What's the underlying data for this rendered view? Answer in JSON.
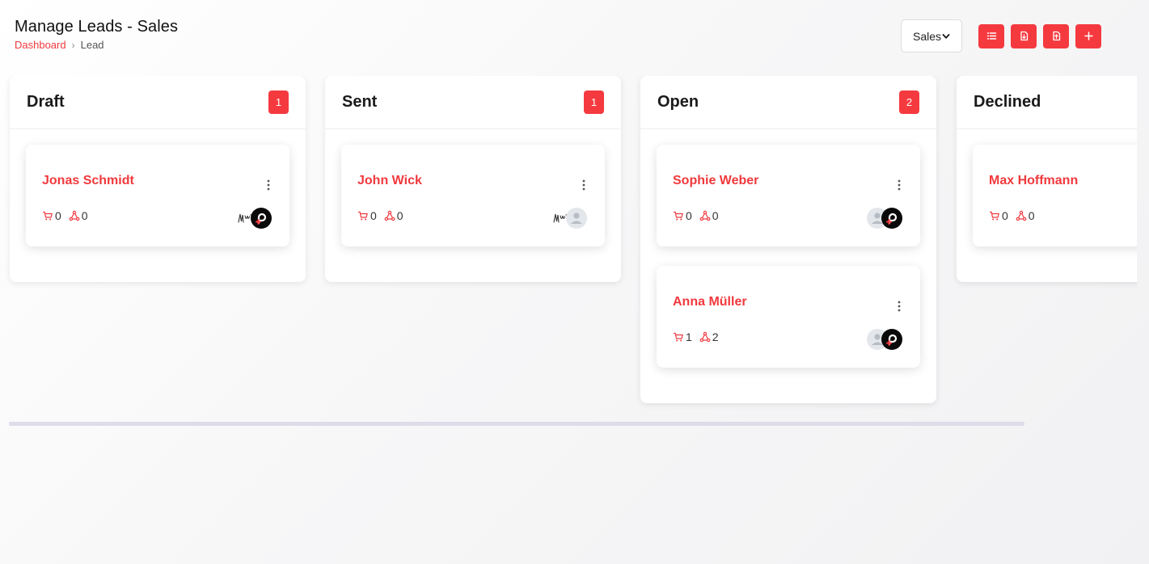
{
  "header": {
    "title": "Manage Leads - Sales",
    "breadcrumb": {
      "link": "Dashboard",
      "separator": "›",
      "current": "Lead"
    }
  },
  "toolbar": {
    "pipeline_select": {
      "value": "Sales"
    },
    "buttons": [
      {
        "name": "list-view-button",
        "icon": "list-icon"
      },
      {
        "name": "import-button",
        "icon": "file-import-icon"
      },
      {
        "name": "export-button",
        "icon": "file-export-icon"
      },
      {
        "name": "add-lead-button",
        "icon": "plus-icon"
      }
    ]
  },
  "colors": {
    "accent": "#f53a3f",
    "lead_name": "#f0393d",
    "text": "#1a1a1a"
  },
  "columns": [
    {
      "title": "Draft",
      "count": "1",
      "cards": [
        {
          "name": "Jonas Schmidt",
          "products": "0",
          "sources": "0",
          "avatars": [
            "signature-avatar",
            "brand-logo-avatar"
          ]
        }
      ]
    },
    {
      "title": "Sent",
      "count": "1",
      "cards": [
        {
          "name": "John Wick",
          "products": "0",
          "sources": "0",
          "avatars": [
            "signature-avatar",
            "default-user-avatar"
          ]
        }
      ]
    },
    {
      "title": "Open",
      "count": "2",
      "cards": [
        {
          "name": "Sophie Weber",
          "products": "0",
          "sources": "0",
          "avatars": [
            "default-user-avatar",
            "brand-logo-avatar"
          ]
        },
        {
          "name": "Anna Müller",
          "products": "1",
          "sources": "2",
          "avatars": [
            "default-user-avatar",
            "brand-logo-avatar"
          ]
        }
      ]
    },
    {
      "title": "Declined",
      "count": "",
      "cards": [
        {
          "name": "Max Hoffmann",
          "products": "0",
          "sources": "0",
          "avatars": []
        }
      ]
    }
  ],
  "icons": {
    "products": "cart-icon",
    "sources": "share-nodes-icon",
    "menu": "kebab-menu-icon"
  }
}
